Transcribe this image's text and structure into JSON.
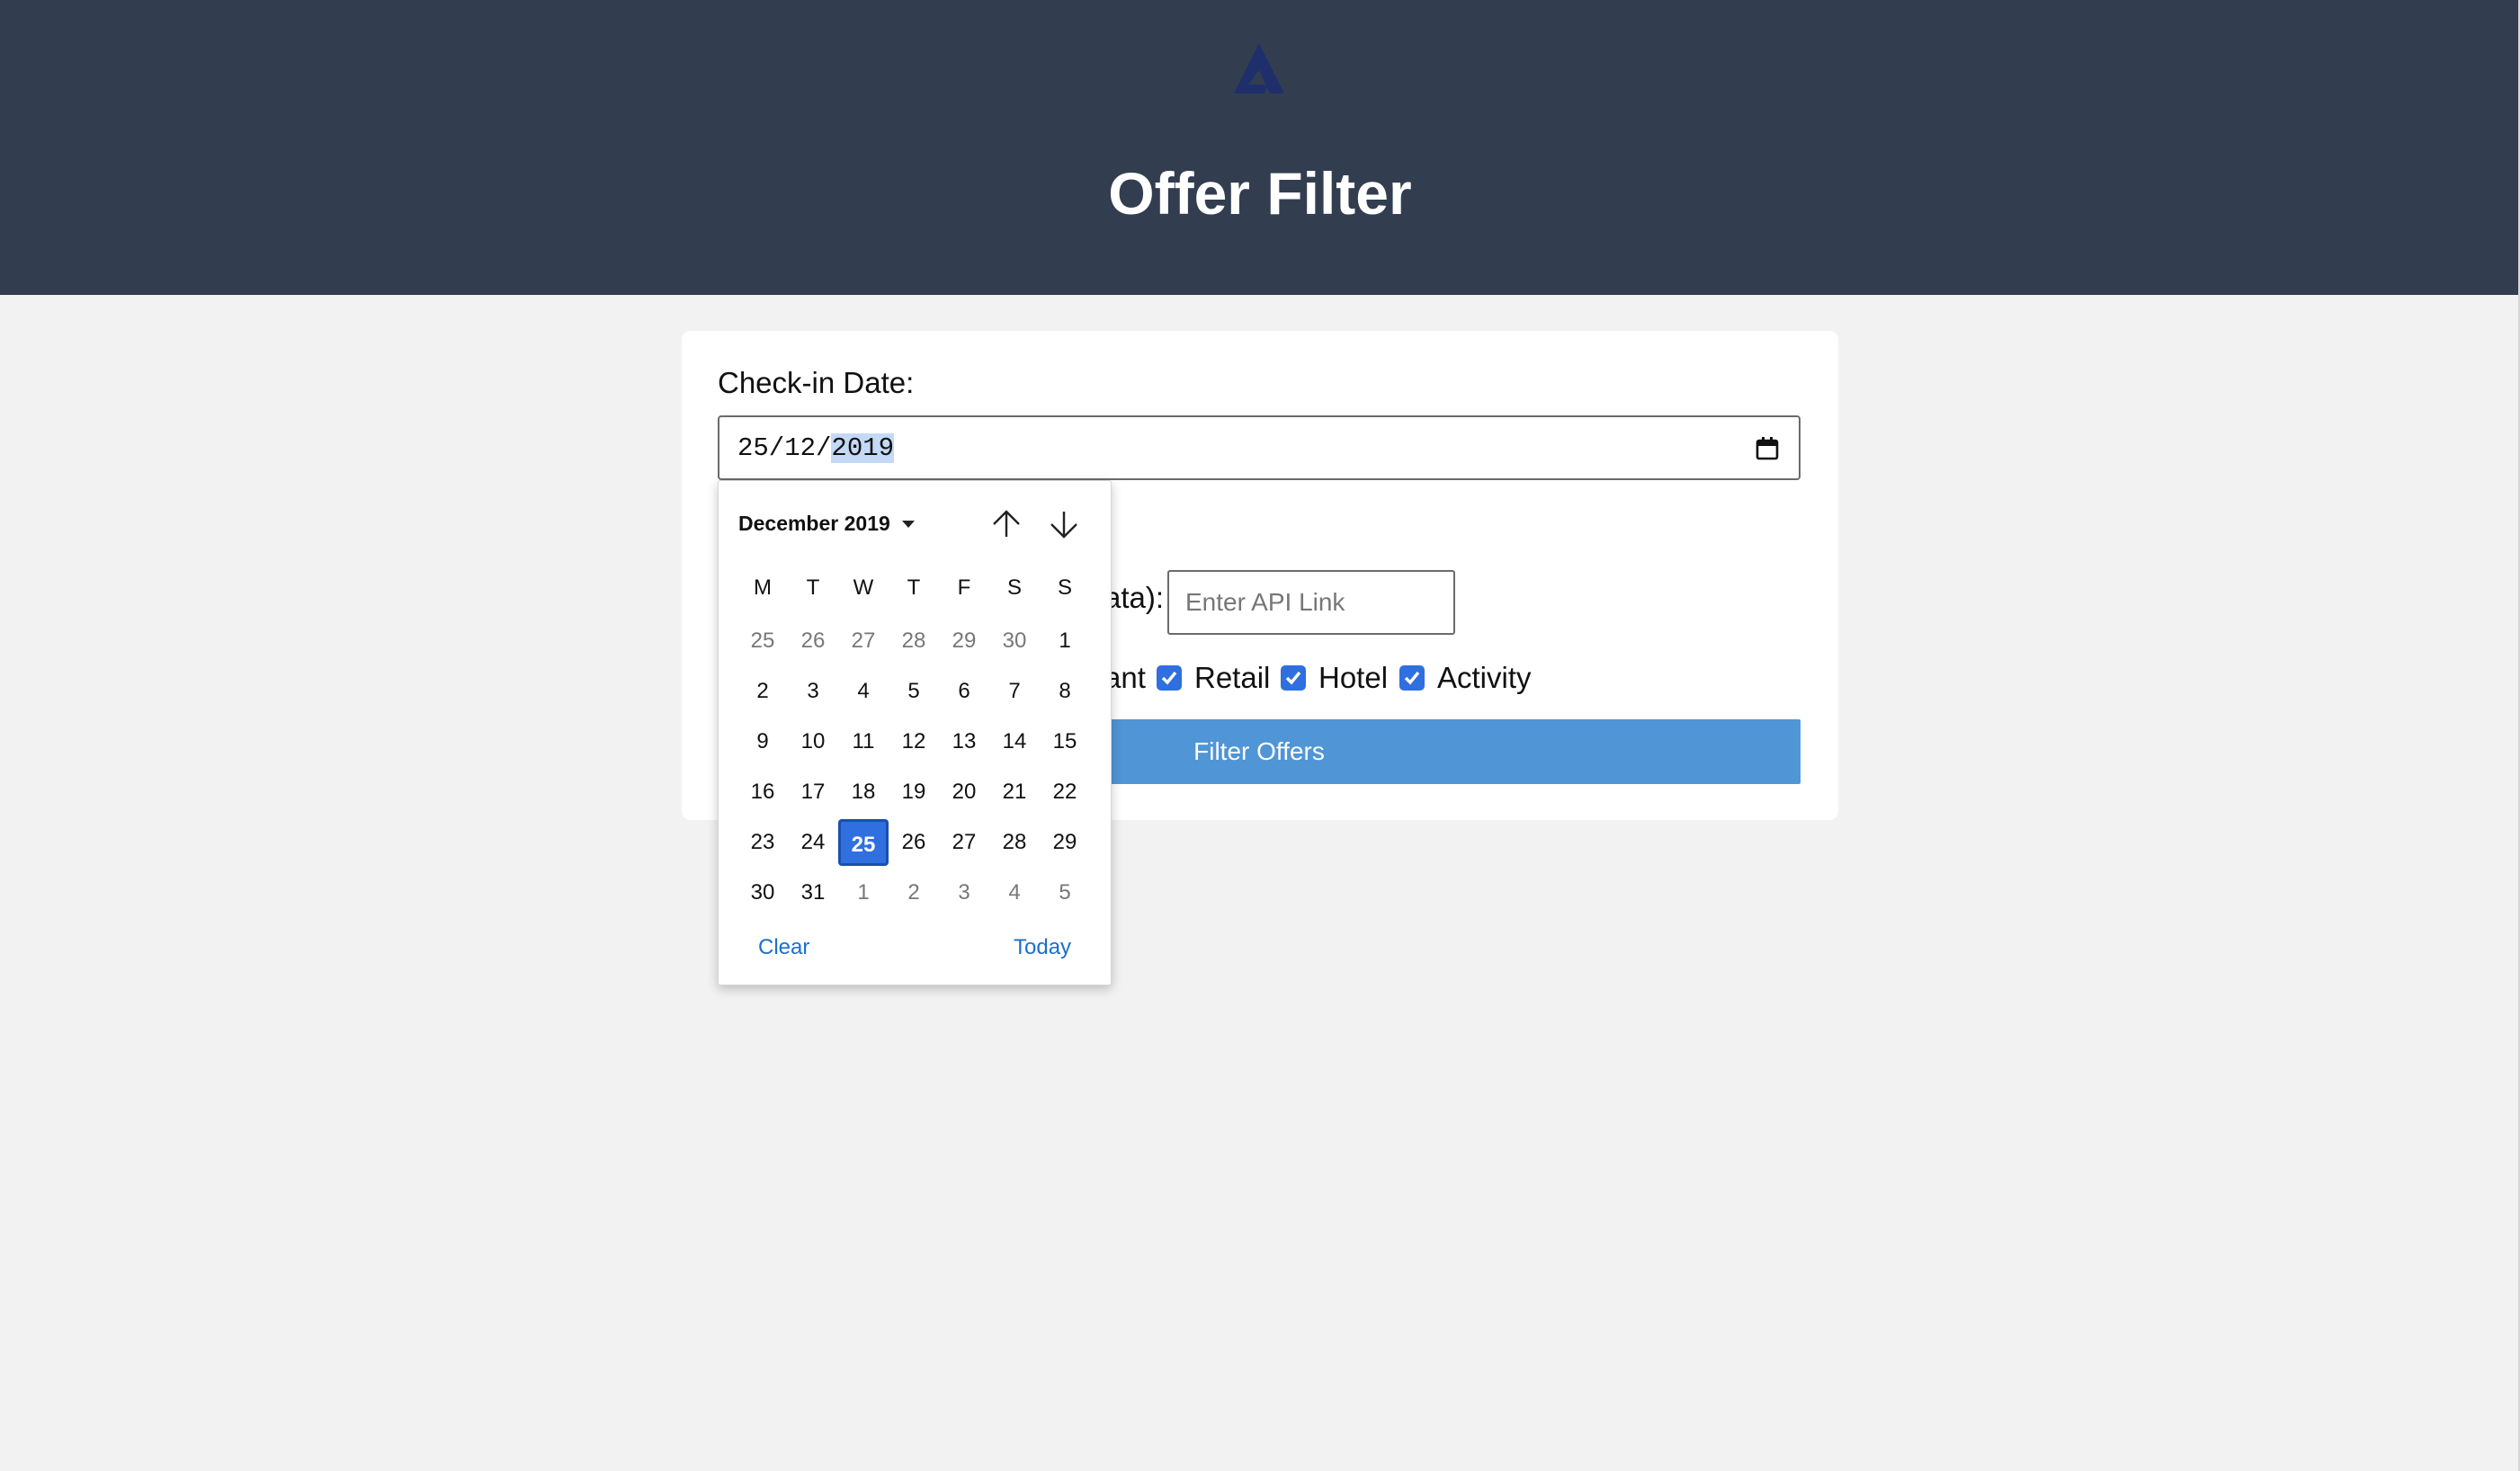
{
  "header": {
    "logo_icon": "triangle-logo-icon",
    "title": "Offer Filter"
  },
  "form": {
    "checkin_label": "Check-in Date:",
    "date_value": {
      "day_month": "25/12/",
      "year": "2019"
    },
    "api_label_partial": "ata):",
    "api_placeholder": "Enter API Link",
    "categories": [
      {
        "label": "ant",
        "checked": true,
        "partial": true
      },
      {
        "label": "Retail",
        "checked": true
      },
      {
        "label": "Hotel",
        "checked": true
      },
      {
        "label": "Activity",
        "checked": true
      }
    ],
    "filter_button": "Filter Offers"
  },
  "date_picker": {
    "month_label": "December 2019",
    "weekdays": [
      "M",
      "T",
      "W",
      "T",
      "F",
      "S",
      "S"
    ],
    "weeks": [
      [
        {
          "d": "25",
          "o": true
        },
        {
          "d": "26",
          "o": true
        },
        {
          "d": "27",
          "o": true
        },
        {
          "d": "28",
          "o": true
        },
        {
          "d": "29",
          "o": true
        },
        {
          "d": "30",
          "o": true
        },
        {
          "d": "1"
        }
      ],
      [
        {
          "d": "2"
        },
        {
          "d": "3"
        },
        {
          "d": "4"
        },
        {
          "d": "5"
        },
        {
          "d": "6"
        },
        {
          "d": "7"
        },
        {
          "d": "8"
        }
      ],
      [
        {
          "d": "9"
        },
        {
          "d": "10"
        },
        {
          "d": "11"
        },
        {
          "d": "12"
        },
        {
          "d": "13"
        },
        {
          "d": "14"
        },
        {
          "d": "15"
        }
      ],
      [
        {
          "d": "16"
        },
        {
          "d": "17"
        },
        {
          "d": "18"
        },
        {
          "d": "19"
        },
        {
          "d": "20"
        },
        {
          "d": "21"
        },
        {
          "d": "22"
        }
      ],
      [
        {
          "d": "23"
        },
        {
          "d": "24"
        },
        {
          "d": "25",
          "s": true
        },
        {
          "d": "26"
        },
        {
          "d": "27"
        },
        {
          "d": "28"
        },
        {
          "d": "29"
        }
      ],
      [
        {
          "d": "30"
        },
        {
          "d": "31"
        },
        {
          "d": "1",
          "o": true
        },
        {
          "d": "2",
          "o": true
        },
        {
          "d": "3",
          "o": true
        },
        {
          "d": "4",
          "o": true
        },
        {
          "d": "5",
          "o": true
        }
      ]
    ],
    "clear_label": "Clear",
    "today_label": "Today"
  },
  "colors": {
    "header_bg": "#323e50",
    "logo": "#1f2f6b",
    "accent": "#2f6fe0",
    "button": "#5095d6"
  }
}
